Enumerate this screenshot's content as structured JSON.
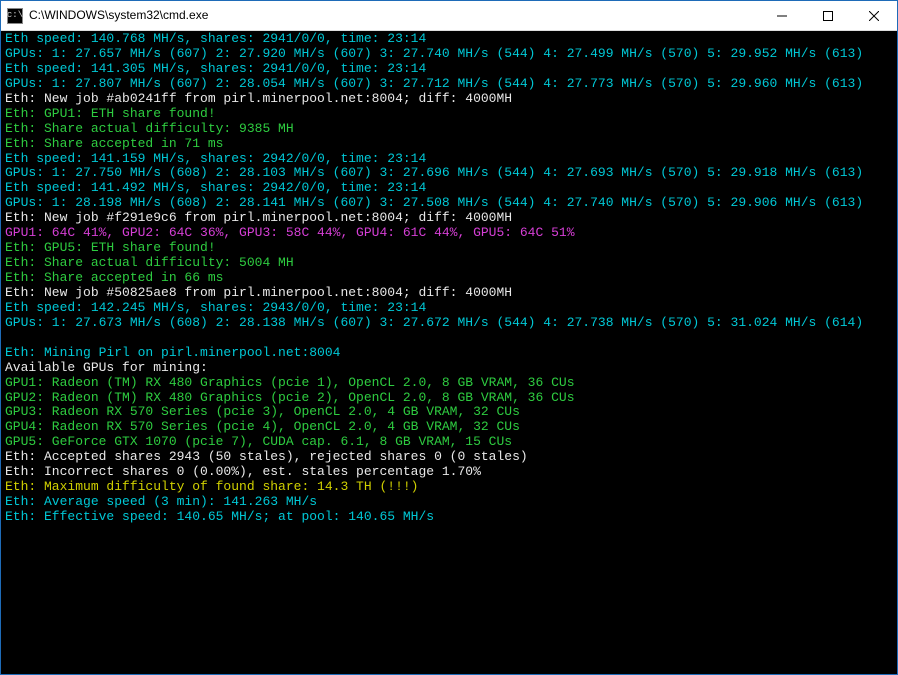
{
  "window": {
    "title": "C:\\WINDOWS\\system32\\cmd.exe"
  },
  "console": {
    "lines": [
      {
        "cls": "c-cyan",
        "text": "Eth speed: 140.768 MH/s, shares: 2941/0/0, time: 23:14"
      },
      {
        "cls": "c-cyan",
        "text": "GPUs: 1: 27.657 MH/s (607) 2: 27.920 MH/s (607) 3: 27.740 MH/s (544) 4: 27.499 MH/s (570) 5: 29.952 MH/s (613)"
      },
      {
        "cls": "c-cyan",
        "text": "Eth speed: 141.305 MH/s, shares: 2941/0/0, time: 23:14"
      },
      {
        "cls": "c-cyan",
        "text": "GPUs: 1: 27.807 MH/s (607) 2: 28.054 MH/s (607) 3: 27.712 MH/s (544) 4: 27.773 MH/s (570) 5: 29.960 MH/s (613)"
      },
      {
        "cls": "c-white",
        "text": "Eth: New job #ab0241ff from pirl.minerpool.net:8004; diff: 4000MH"
      },
      {
        "cls": "c-green",
        "text": "Eth: GPU1: ETH share found!"
      },
      {
        "cls": "c-green",
        "text": "Eth: Share actual difficulty: 9385 MH"
      },
      {
        "cls": "c-green",
        "text": "Eth: Share accepted in 71 ms"
      },
      {
        "cls": "c-cyan",
        "text": "Eth speed: 141.159 MH/s, shares: 2942/0/0, time: 23:14"
      },
      {
        "cls": "c-cyan",
        "text": "GPUs: 1: 27.750 MH/s (608) 2: 28.103 MH/s (607) 3: 27.696 MH/s (544) 4: 27.693 MH/s (570) 5: 29.918 MH/s (613)"
      },
      {
        "cls": "c-cyan",
        "text": "Eth speed: 141.492 MH/s, shares: 2942/0/0, time: 23:14"
      },
      {
        "cls": "c-cyan",
        "text": "GPUs: 1: 28.198 MH/s (608) 2: 28.141 MH/s (607) 3: 27.508 MH/s (544) 4: 27.740 MH/s (570) 5: 29.906 MH/s (613)"
      },
      {
        "cls": "c-white",
        "text": "Eth: New job #f291e9c6 from pirl.minerpool.net:8004; diff: 4000MH"
      },
      {
        "cls": "c-magenta",
        "text": "GPU1: 64C 41%, GPU2: 64C 36%, GPU3: 58C 44%, GPU4: 61C 44%, GPU5: 64C 51%"
      },
      {
        "cls": "c-green",
        "text": "Eth: GPU5: ETH share found!"
      },
      {
        "cls": "c-green",
        "text": "Eth: Share actual difficulty: 5004 MH"
      },
      {
        "cls": "c-green",
        "text": "Eth: Share accepted in 66 ms"
      },
      {
        "cls": "c-white",
        "text": "Eth: New job #50825ae8 from pirl.minerpool.net:8004; diff: 4000MH"
      },
      {
        "cls": "c-cyan",
        "text": "Eth speed: 142.245 MH/s, shares: 2943/0/0, time: 23:14"
      },
      {
        "cls": "c-cyan",
        "text": "GPUs: 1: 27.673 MH/s (608) 2: 28.138 MH/s (607) 3: 27.672 MH/s (544) 4: 27.738 MH/s (570) 5: 31.024 MH/s (614)"
      },
      {
        "cls": "",
        "text": " "
      },
      {
        "cls": "c-cyan",
        "text": "Eth: Mining Pirl on pirl.minerpool.net:8004"
      },
      {
        "cls": "c-white",
        "text": "Available GPUs for mining:"
      },
      {
        "cls": "c-green",
        "text": "GPU1: Radeon (TM) RX 480 Graphics (pcie 1), OpenCL 2.0, 8 GB VRAM, 36 CUs"
      },
      {
        "cls": "c-green",
        "text": "GPU2: Radeon (TM) RX 480 Graphics (pcie 2), OpenCL 2.0, 8 GB VRAM, 36 CUs"
      },
      {
        "cls": "c-green",
        "text": "GPU3: Radeon RX 570 Series (pcie 3), OpenCL 2.0, 4 GB VRAM, 32 CUs"
      },
      {
        "cls": "c-green",
        "text": "GPU4: Radeon RX 570 Series (pcie 4), OpenCL 2.0, 4 GB VRAM, 32 CUs"
      },
      {
        "cls": "c-green",
        "text": "GPU5: GeForce GTX 1070 (pcie 7), CUDA cap. 6.1, 8 GB VRAM, 15 CUs"
      },
      {
        "cls": "c-white",
        "text": "Eth: Accepted shares 2943 (50 stales), rejected shares 0 (0 stales)"
      },
      {
        "cls": "c-white",
        "text": "Eth: Incorrect shares 0 (0.00%), est. stales percentage 1.70%"
      },
      {
        "cls": "c-yellow",
        "text": "Eth: Maximum difficulty of found share: 14.3 TH (!!!)"
      },
      {
        "cls": "c-cyan",
        "text": "Eth: Average speed (3 min): 141.263 MH/s"
      },
      {
        "cls": "c-cyan",
        "text": "Eth: Effective speed: 140.65 MH/s; at pool: 140.65 MH/s"
      }
    ]
  }
}
